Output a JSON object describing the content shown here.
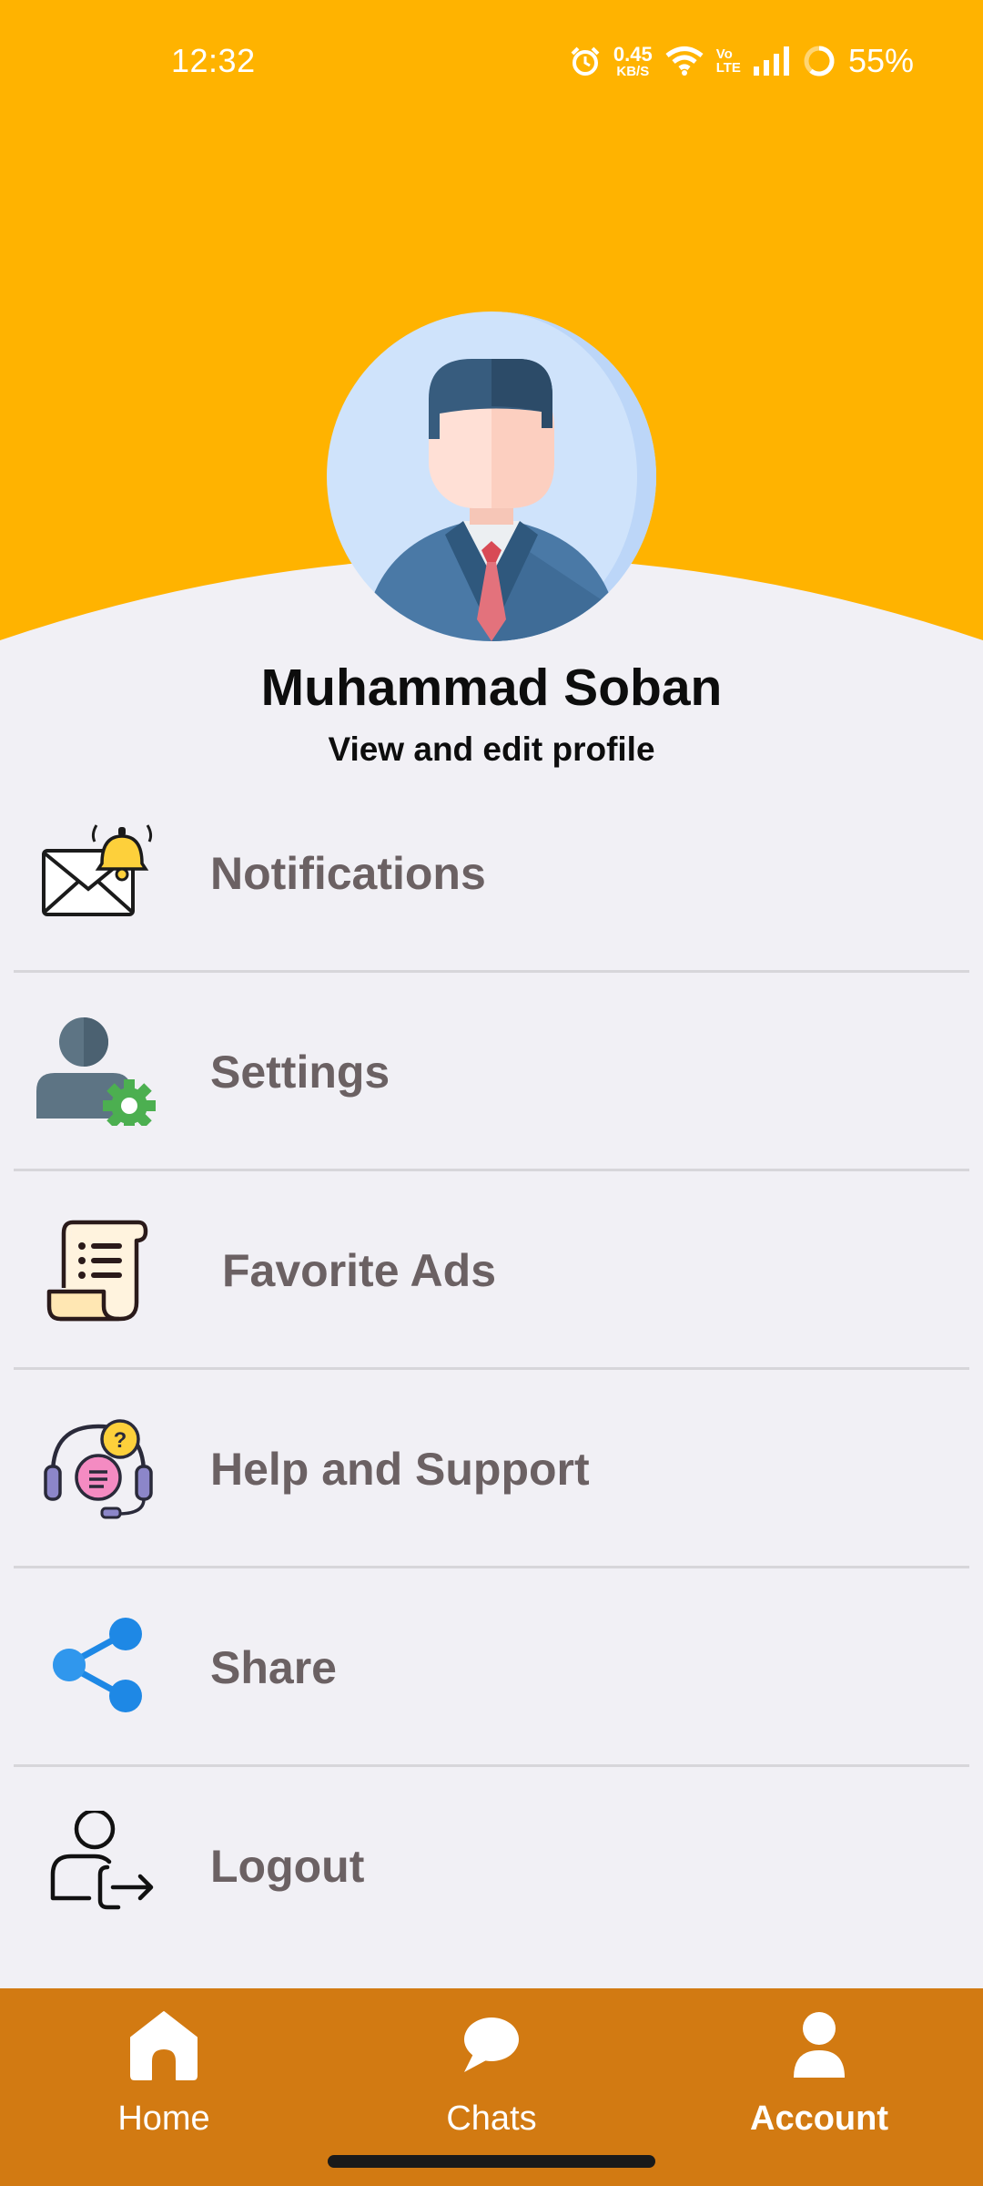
{
  "status_bar": {
    "time": "12:32",
    "net_speed": "0.45",
    "net_unit": "KB/S",
    "volte_top": "Vo",
    "volte_bottom": "LTE",
    "battery": "55%",
    "icons": [
      "alarm-icon",
      "wifi-icon",
      "volte-icon",
      "signal-icon",
      "battery-ring-icon"
    ]
  },
  "profile": {
    "name": "Muhammad Soban",
    "edit_label": "View and edit profile",
    "avatar": "businessman-avatar"
  },
  "menu": {
    "items": [
      {
        "label": "Notifications",
        "icon": "envelope-bell-icon"
      },
      {
        "label": "Settings",
        "icon": "user-gear-icon"
      },
      {
        "label": "Favorite Ads",
        "icon": "scroll-list-icon"
      },
      {
        "label": "Help and Support",
        "icon": "headset-support-icon"
      },
      {
        "label": "Share",
        "icon": "share-icon"
      },
      {
        "label": "Logout",
        "icon": "user-logout-icon"
      }
    ]
  },
  "bottom_nav": {
    "items": [
      {
        "label": "Home",
        "icon": "home-icon",
        "active": false
      },
      {
        "label": "Chats",
        "icon": "chat-bubble-icon",
        "active": false
      },
      {
        "label": "Account",
        "icon": "user-icon",
        "active": true
      }
    ]
  },
  "colors": {
    "header": "#FFB300",
    "background": "#F1F0F5",
    "nav_bar": "#D27A12",
    "menu_text": "#6B6163"
  }
}
